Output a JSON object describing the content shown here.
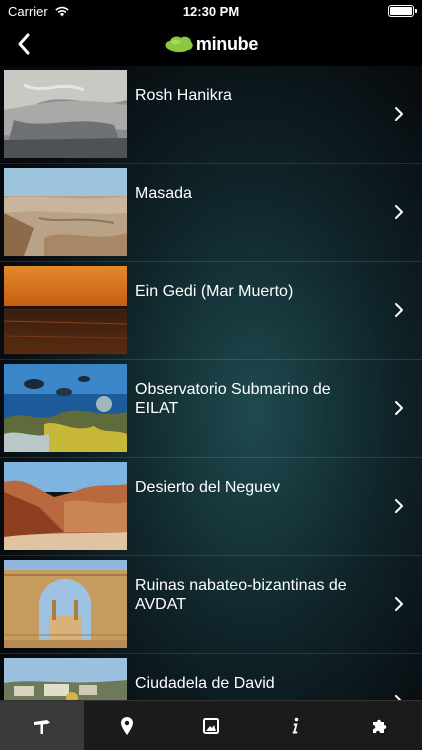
{
  "status": {
    "carrier": "Carrier",
    "time": "12:30 PM"
  },
  "nav": {
    "back_icon": "chevron-left-icon",
    "logo_text": "minube",
    "accent": "#8dc63f"
  },
  "places": [
    {
      "title": "Rosh Hanikra"
    },
    {
      "title": "Masada"
    },
    {
      "title": "Ein Gedi (Mar Muerto)"
    },
    {
      "title": "Observatorio Submarino de EILAT"
    },
    {
      "title": "Desierto del Neguev"
    },
    {
      "title": "Ruinas nabateo-bizantinas de AVDAT"
    },
    {
      "title": "Ciudadela de David"
    }
  ],
  "tabs": [
    {
      "icon": "signpost-icon",
      "active": true
    },
    {
      "icon": "location-pin-icon",
      "active": false
    },
    {
      "icon": "photo-icon",
      "active": false
    },
    {
      "icon": "info-icon",
      "active": false
    },
    {
      "icon": "puzzle-icon",
      "active": false
    }
  ]
}
